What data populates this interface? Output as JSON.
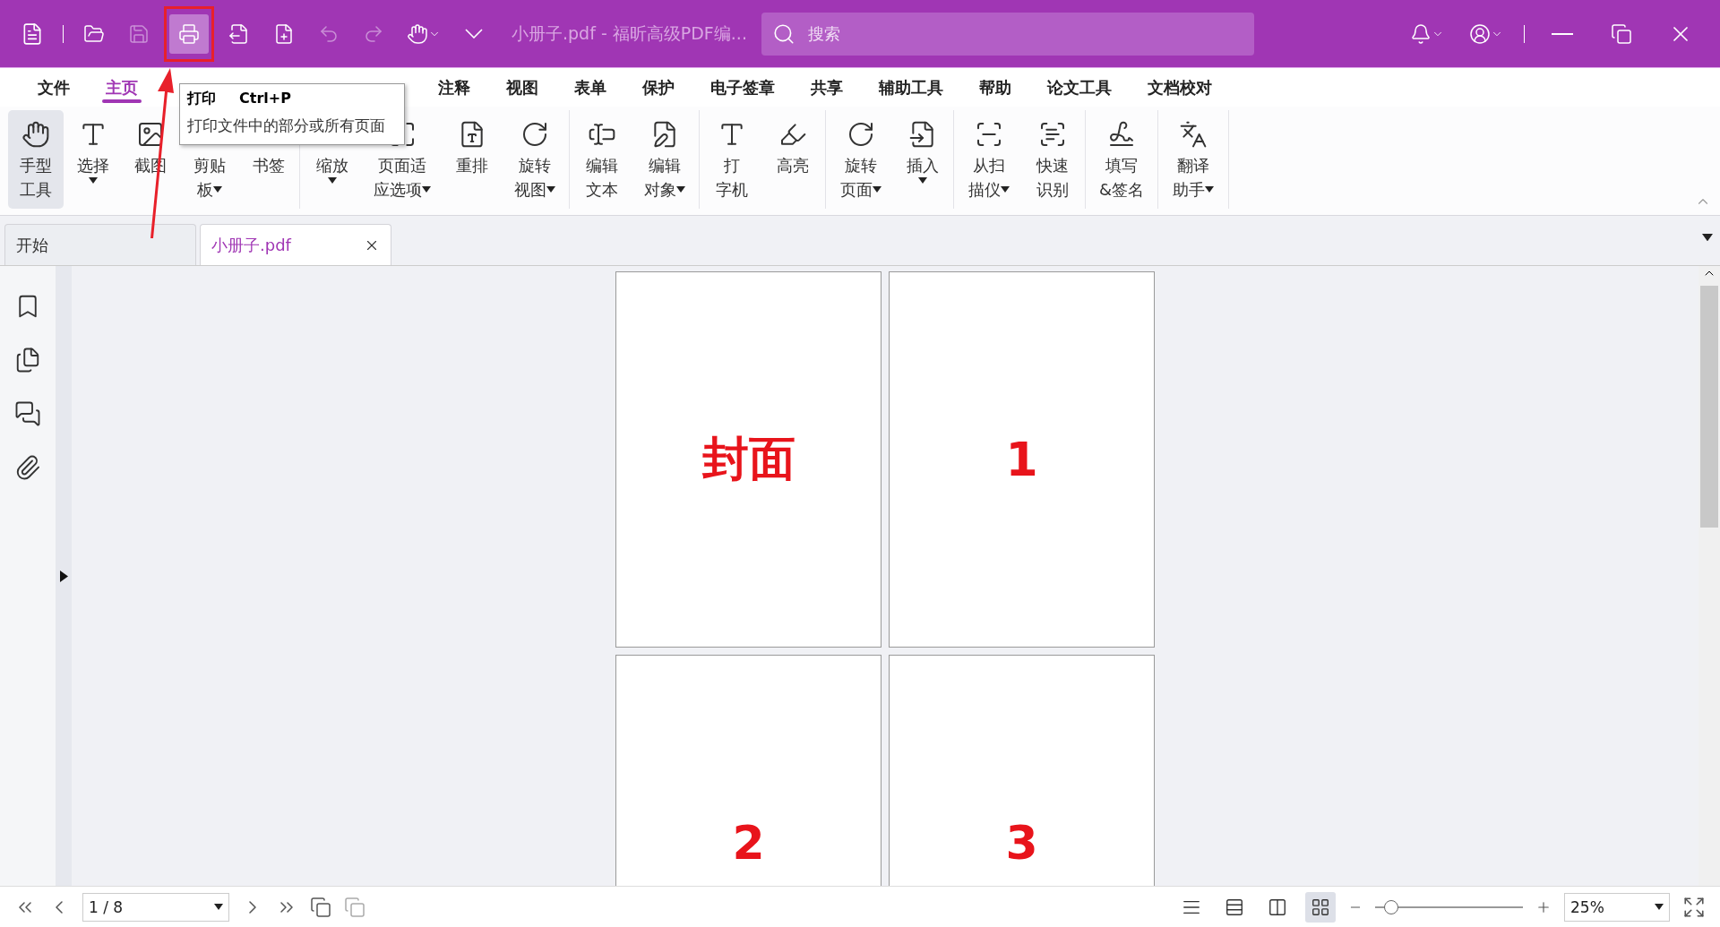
{
  "title_bar": {
    "title": "小册子.pdf - 福昕高级PDF编...",
    "search": {
      "placeholder": "搜索"
    },
    "print_highlighted": true
  },
  "menu_tabs": [
    {
      "label": "文件",
      "selected": false
    },
    {
      "label": "主页",
      "selected": true
    },
    {
      "label": "注释",
      "selected": false
    },
    {
      "label": "视图",
      "selected": false
    },
    {
      "label": "表单",
      "selected": false
    },
    {
      "label": "保护",
      "selected": false
    },
    {
      "label": "电子签章",
      "selected": false
    },
    {
      "label": "共享",
      "selected": false
    },
    {
      "label": "辅助工具",
      "selected": false
    },
    {
      "label": "帮助",
      "selected": false
    },
    {
      "label": "论文工具",
      "selected": false
    },
    {
      "label": "文档校对",
      "selected": false
    }
  ],
  "ribbon": {
    "groups": [
      [
        {
          "kind": "plain",
          "lines": [
            "手型",
            "工具"
          ],
          "selected": true,
          "covered": false
        },
        {
          "kind": "dropdown-below",
          "lines": [
            "选择"
          ],
          "selected": false,
          "covered": false
        },
        {
          "kind": "plain",
          "lines": [
            "截图"
          ],
          "selected": false,
          "covered": false
        },
        {
          "kind": "dropdown-inline",
          "lines": [
            "剪贴",
            "板"
          ],
          "covered": true,
          "selected": false
        },
        {
          "kind": "plain",
          "lines": [
            "书签"
          ],
          "covered": true,
          "selected": false
        }
      ],
      [
        {
          "kind": "dropdown-below",
          "lines": [
            "缩放"
          ],
          "covered": true,
          "selected": false
        },
        {
          "kind": "dropdown-inline",
          "lines": [
            "页面适",
            "应选项"
          ],
          "selected": false,
          "covered": false
        },
        {
          "kind": "plain",
          "lines": [
            "重排"
          ],
          "selected": false,
          "covered": false
        },
        {
          "kind": "dropdown-inline",
          "lines": [
            "旋转",
            "视图"
          ],
          "selected": false,
          "covered": false
        }
      ],
      [
        {
          "kind": "plain",
          "lines": [
            "编辑",
            "文本"
          ],
          "selected": false,
          "covered": false
        },
        {
          "kind": "dropdown-inline",
          "lines": [
            "编辑",
            "对象"
          ],
          "selected": false,
          "covered": false
        }
      ],
      [
        {
          "kind": "plain",
          "lines": [
            "打",
            "字机"
          ],
          "selected": false,
          "covered": false
        },
        {
          "kind": "plain",
          "lines": [
            "高亮"
          ],
          "selected": false,
          "covered": false
        }
      ],
      [
        {
          "kind": "dropdown-inline",
          "lines": [
            "旋转",
            "页面"
          ],
          "selected": false,
          "covered": false
        },
        {
          "kind": "dropdown-below",
          "lines": [
            "插入"
          ],
          "selected": false,
          "covered": false
        }
      ],
      [
        {
          "kind": "dropdown-inline",
          "lines": [
            "从扫",
            "描仪"
          ],
          "selected": false,
          "covered": false
        },
        {
          "kind": "plain",
          "lines": [
            "快速",
            "识别"
          ],
          "selected": false,
          "covered": false
        }
      ],
      [
        {
          "kind": "plain",
          "lines": [
            "填写",
            "&签名"
          ],
          "selected": false,
          "covered": false
        }
      ],
      [
        {
          "kind": "dropdown-inline",
          "lines": [
            "翻译",
            "助手"
          ],
          "selected": false,
          "covered": false
        }
      ]
    ]
  },
  "tooltip": {
    "title": "打印",
    "shortcut": "Ctrl+P",
    "description": "打印文件中的部分或所有页面"
  },
  "doc_tabs": [
    {
      "label": "开始",
      "selected": false,
      "closable": false
    },
    {
      "label": "小册子.pdf",
      "selected": true,
      "closable": true
    }
  ],
  "pages": [
    "封面",
    "1",
    "2",
    "3"
  ],
  "status_bar": {
    "page_field": "1 / 8",
    "zoom_slider": {
      "level": 0.1
    },
    "zoom_field": "25%",
    "view_modes": [
      {
        "selected": false
      },
      {
        "selected": false
      },
      {
        "selected": false
      },
      {
        "selected": true
      }
    ]
  }
}
